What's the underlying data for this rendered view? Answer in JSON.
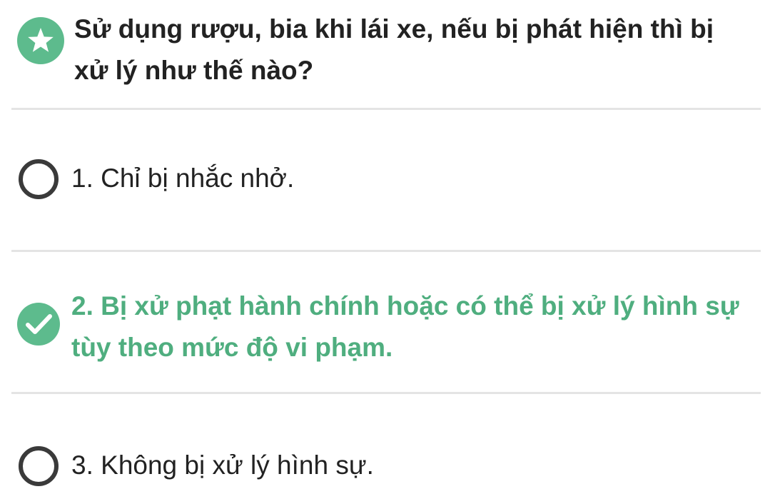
{
  "question": {
    "badge_icon": "star-icon",
    "text": "Sử dụng rượu, bia khi lái xe, nếu bị phát hiện thì bị xử lý như thế nào?"
  },
  "answers": [
    {
      "label": "1. Chỉ bị nhắc nhở.",
      "state": "unselected",
      "icon": "radio-empty-icon"
    },
    {
      "label": "2. Bị xử phạt hành chính hoặc có thể bị xử lý hình sự tùy theo mức độ vi phạm.",
      "state": "correct",
      "icon": "check-icon"
    },
    {
      "label": "3. Không bị xử lý hình sự.",
      "state": "unselected",
      "icon": "radio-empty-icon"
    }
  ],
  "colors": {
    "accent_green": "#5dbb8d",
    "correct_text": "#4fae7f",
    "text": "#222222",
    "divider": "#e4e4e4"
  }
}
